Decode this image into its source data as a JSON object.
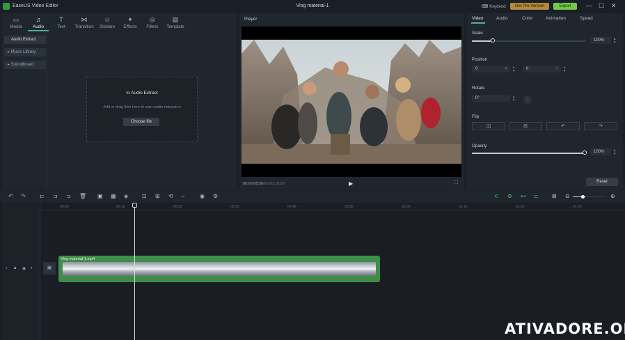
{
  "app": {
    "name": "EaseUS Video Editor",
    "document_title": "Vlog material-1"
  },
  "titlebar": {
    "keybind": "Keybind",
    "get_pro": "Get Pro Version",
    "export": "Export"
  },
  "left_tabs": [
    {
      "label": "Media",
      "icon": "folder-icon"
    },
    {
      "label": "Audio",
      "icon": "music-icon"
    },
    {
      "label": "Text",
      "icon": "text-icon"
    },
    {
      "label": "Transition",
      "icon": "transition-icon"
    },
    {
      "label": "Stickers",
      "icon": "sticker-icon"
    },
    {
      "label": "Effects",
      "icon": "effects-icon"
    },
    {
      "label": "Filters",
      "icon": "filter-icon"
    },
    {
      "label": "Template",
      "icon": "template-icon"
    }
  ],
  "audio_sidebar": {
    "items": [
      "Audio Extract",
      "Music Library",
      "Soundboard"
    ]
  },
  "dropzone": {
    "title": "Audio Extract",
    "subtitle": "Add or drag files here to start audio extraction",
    "button": "Choose file"
  },
  "player": {
    "label": "Player",
    "current_time": "00:00:08:30",
    "total_time": "/00:00:16:50"
  },
  "properties": {
    "tabs": [
      "Video",
      "Audio",
      "Color",
      "Animation",
      "Speed"
    ],
    "scale": {
      "label": "Scale",
      "value": "100%",
      "level": 1.0
    },
    "position": {
      "label": "Position",
      "x": "0",
      "x_unit": "X",
      "y": "0",
      "y_unit": "Y"
    },
    "rotate": {
      "label": "Rotate",
      "value": "0°"
    },
    "flip": {
      "label": "Flip"
    },
    "opacity": {
      "label": "Opacity",
      "value": "100%",
      "level": 1.0
    },
    "reset": "Reset"
  },
  "timeline": {
    "ruler": [
      "00:00",
      "00:10",
      "00:20",
      "00:30",
      "00:40",
      "00:50",
      "01:00",
      "01:10",
      "01:20",
      "01:30"
    ],
    "clip_name": "Vlog material-1.mp4"
  },
  "watermark": "ATIVADORE.ORG",
  "colors": {
    "accent": "#49b0a4",
    "export": "#72c94a",
    "pro": "#b08a3e",
    "clip": "#3f8d4a"
  }
}
